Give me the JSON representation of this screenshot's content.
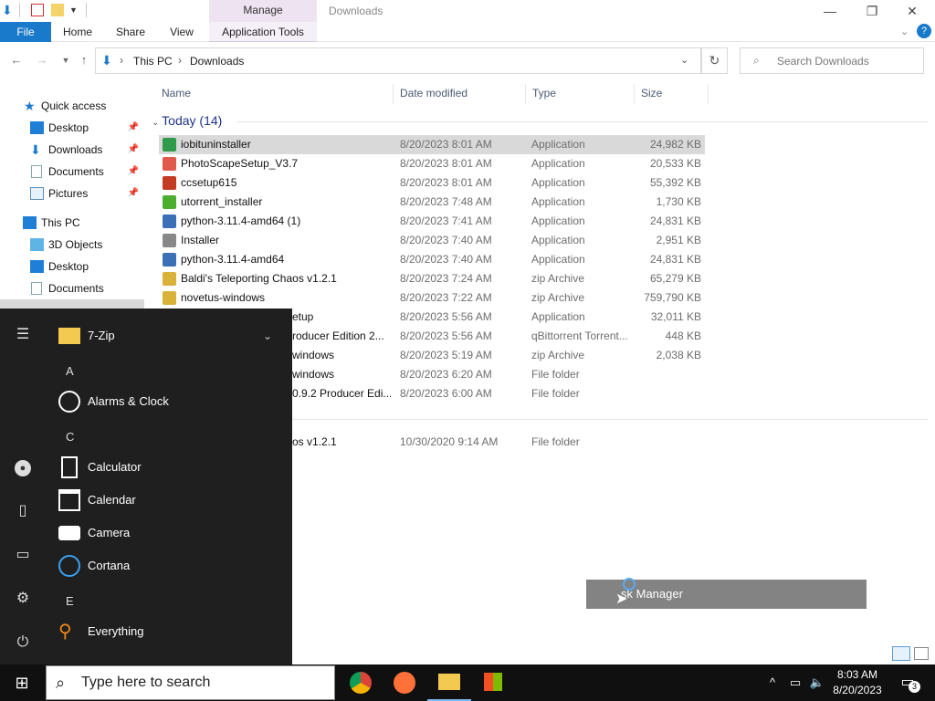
{
  "window": {
    "title": "Downloads",
    "context_tab_header": "Manage",
    "controls": {
      "minimize": "—",
      "maximize": "❐",
      "close": "✕"
    }
  },
  "ribbon": {
    "tabs": [
      "File",
      "Home",
      "Share",
      "View",
      "Application Tools"
    ]
  },
  "address": {
    "path": [
      "This PC",
      "Downloads"
    ],
    "search_placeholder": "Search Downloads"
  },
  "nav": {
    "quick_access": "Quick access",
    "items": [
      "Desktop",
      "Downloads",
      "Documents",
      "Pictures"
    ],
    "this_pc": "This PC",
    "pc_items": [
      "3D Objects",
      "Desktop",
      "Documents"
    ]
  },
  "columns": [
    "Name",
    "Date modified",
    "Type",
    "Size"
  ],
  "group_label": "Today (14)",
  "files": [
    {
      "name": "iobituninstaller",
      "date": "8/20/2023 8:01 AM",
      "type": "Application",
      "size": "24,982 KB"
    },
    {
      "name": "PhotoScapeSetup_V3.7",
      "date": "8/20/2023 8:01 AM",
      "type": "Application",
      "size": "20,533 KB"
    },
    {
      "name": "ccsetup615",
      "date": "8/20/2023 8:01 AM",
      "type": "Application",
      "size": "55,392 KB"
    },
    {
      "name": "utorrent_installer",
      "date": "8/20/2023 7:48 AM",
      "type": "Application",
      "size": "1,730 KB"
    },
    {
      "name": "python-3.11.4-amd64 (1)",
      "date": "8/20/2023 7:41 AM",
      "type": "Application",
      "size": "24,831 KB"
    },
    {
      "name": "Installer",
      "date": "8/20/2023 7:40 AM",
      "type": "Application",
      "size": "2,951 KB"
    },
    {
      "name": "python-3.11.4-amd64",
      "date": "8/20/2023 7:40 AM",
      "type": "Application",
      "size": "24,831 KB"
    },
    {
      "name": "Baldi's Teleporting Chaos v1.2.1",
      "date": "8/20/2023 7:24 AM",
      "type": "zip Archive",
      "size": "65,279 KB"
    },
    {
      "name": "novetus-windows",
      "date": "8/20/2023 7:22 AM",
      "type": "zip Archive",
      "size": "759,790 KB"
    },
    {
      "name": "etup",
      "date": "8/20/2023 5:56 AM",
      "type": "Application",
      "size": "32,011 KB"
    },
    {
      "name": "roducer Edition 2...",
      "date": "8/20/2023 5:56 AM",
      "type": "qBittorrent Torrent...",
      "size": "448 KB"
    },
    {
      "name": "windows",
      "date": "8/20/2023 5:19 AM",
      "type": "zip Archive",
      "size": "2,038 KB"
    },
    {
      "name": "windows",
      "date": "8/20/2023 6:20 AM",
      "type": "File folder",
      "size": ""
    },
    {
      "name": "0.9.2 Producer Edi...",
      "date": "8/20/2023 6:00 AM",
      "type": "File folder",
      "size": ""
    },
    {
      "name": "os v1.2.1",
      "date": "10/30/2020 9:14 AM",
      "type": "File folder",
      "size": ""
    }
  ],
  "start_menu": {
    "top_folder": "7-Zip",
    "letters": [
      "A",
      "C",
      "E"
    ],
    "apps": [
      "Alarms & Clock",
      "Calculator",
      "Calendar",
      "Camera",
      "Cortana",
      "Everything"
    ]
  },
  "tooltip": "sk Manager",
  "taskbar": {
    "search_placeholder": "Type here to search",
    "time": "8:03 AM",
    "date": "8/20/2023",
    "notification_count": "3"
  },
  "colors": {
    "accent": "#1979ca",
    "start_bg": "#1f1f1f",
    "taskbar": "#101010",
    "selection": "#d9d9d9"
  }
}
